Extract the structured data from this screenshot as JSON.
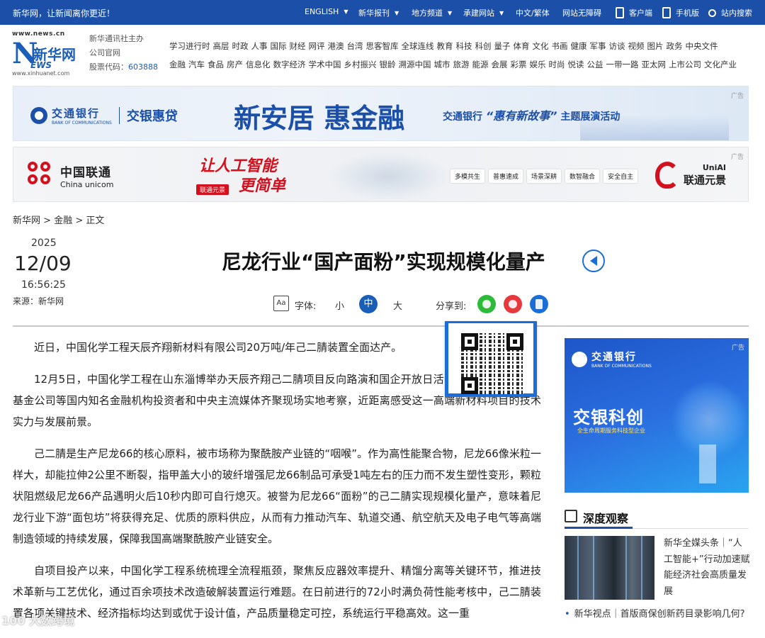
{
  "topbar": {
    "slogan": "新华网，让新闻离你更近！",
    "nav": [
      {
        "label": "ENGLISH",
        "has_caret": true
      },
      {
        "label": "新华报刊",
        "has_caret": true
      },
      {
        "label": "地方频道",
        "has_caret": true
      },
      {
        "label": "承建网站",
        "has_caret": true
      },
      {
        "label": "中文/繁体",
        "has_caret": false
      },
      {
        "label": "网站无障碍",
        "has_caret": false
      },
      {
        "label": "客户端",
        "icon": "mobile-icon"
      },
      {
        "label": "手机版",
        "icon": "phone-icon"
      },
      {
        "label": "站内搜索",
        "icon": "search-icon"
      }
    ]
  },
  "header": {
    "logo_url": "www.news.cn",
    "logo_cn": "新华网",
    "logo_n": "N",
    "logo_ews": "EWS",
    "logo_small": "www.xinhuanet.com",
    "sponsor_line1": "新华通讯社主办",
    "sponsor_line2": "公司官网",
    "stock_label": "股票代码：",
    "stock_code": "603888",
    "channels_row1": [
      "学习进行时",
      "高层",
      "时政",
      "人事",
      "国际",
      "财经",
      "网评",
      "港澳",
      "台湾",
      "思客智库",
      "全球连线",
      "教育",
      "科技",
      "科创",
      "量子",
      "体育",
      "文化",
      "书画",
      "健康",
      "军事",
      "访谈",
      "视频",
      "图片",
      "政务",
      "中央文件"
    ],
    "channels_row2": [
      "金融",
      "汽车",
      "食品",
      "房产",
      "信息化",
      "数字经济",
      "学术中国",
      "乡村振兴",
      "银龄",
      "溯源中国",
      "城市",
      "旅游",
      "能源",
      "会展",
      "彩票",
      "娱乐",
      "时尚",
      "悦读",
      "公益",
      "一带一路",
      "亚太网",
      "上市公司",
      "文化产业"
    ]
  },
  "ads": {
    "tag": "广告",
    "ad1": {
      "brand": "交通银行",
      "brand_en": "BANK OF COMMUNICATIONS",
      "product": "交银惠贷",
      "slogan": "新安居 惠金融",
      "campaign_prefix": "交通银行",
      "campaign_quote": "“惠有新故事”",
      "campaign_suffix": "主题展演活动"
    },
    "ad2": {
      "brand": "中国联通",
      "brand_en": "China unicom",
      "slogan_line1": "让人工智能",
      "slogan_line2": "更简单",
      "badge": "联通元景",
      "features": [
        "多模共生",
        "普惠速成",
        "场景深耕",
        "数智融合",
        "安全自主"
      ],
      "right_brand_top": "UniAI",
      "right_brand": "联通元景"
    }
  },
  "breadcrumb": {
    "items": [
      "新华网",
      "金融",
      "正文"
    ],
    "sep": " > "
  },
  "meta": {
    "year": "2025",
    "month_day": "12/09",
    "time": "16:56:25",
    "source": "来源：新华网"
  },
  "article": {
    "title": "尼龙行业“国产面粉”实现规模化量产",
    "font_label": "字体:",
    "font_icon": "Aa",
    "font_sizes": [
      "小",
      "中",
      "大"
    ],
    "font_selected": "中",
    "share_label": "分享到:",
    "paragraphs": [
      "近日，中国化学工程天辰齐翔新材料有限公司20万吨/年己二腈装置全面达产。",
      "12月5日，中国化学工程在山东淄博举办天辰齐翔己二腈项目反向路演和国企开放日活动，邀请多家证券、基金公司等国内知名金融机构投资者和中央主流媒体齐聚现场实地考察，近距离感受这一高端新材料项目的技术实力与发展前景。",
      "己二腈是生产尼龙66的核心原料，被市场称为聚酰胺产业链的“咽喉”。作为高性能聚合物，尼龙66像米粒一样大，却能拉伸2公里不断裂，指甲盖大小的玻纤增强尼龙66制品可承受1吨左右的压力而不发生塑性变形，颗粒状阻燃级尼龙66产品遇明火后10秒内即可自行熄灭。被誉为尼龙66“面粉”的己二腈实现规模化量产，意味着尼龙行业下游“面包坊”将获得充足、优质的原料供应，从而有力推动汽车、轨道交通、航空航天及电子电气等高端制造领域的持续发展，保障我国高端聚酰胺产业链安全。",
      "自项目投产以来，中国化学工程系统梳理全流程瓶颈，聚焦反应器效率提升、精馏分离等关键环节，推进技术革新与工艺优化，通过百余项技术改造破解装置运行难题。在日前进行的72小时满负荷性能考核中，己二腈装置各项关键技术、经济指标均达到或优于设计值，产品质量稳定可控，系统运行平稳高效。这一重"
    ]
  },
  "sidebar": {
    "ad_tag": "广告",
    "ad_brand": "交通银行",
    "ad_brand_en": "BANK OF COMMUNICATIONS",
    "ad_title": "交银科创",
    "ad_sub": "全生命周期服务科技型企业",
    "section_title": "深度观察",
    "feature_title": "新华全媒头条｜“人工智能+”行动加速赋能经济社会高质量发展",
    "news_item": "新华视点｜首版商保创新药目录影响几何?"
  },
  "watermark": "100 大数跨境"
}
